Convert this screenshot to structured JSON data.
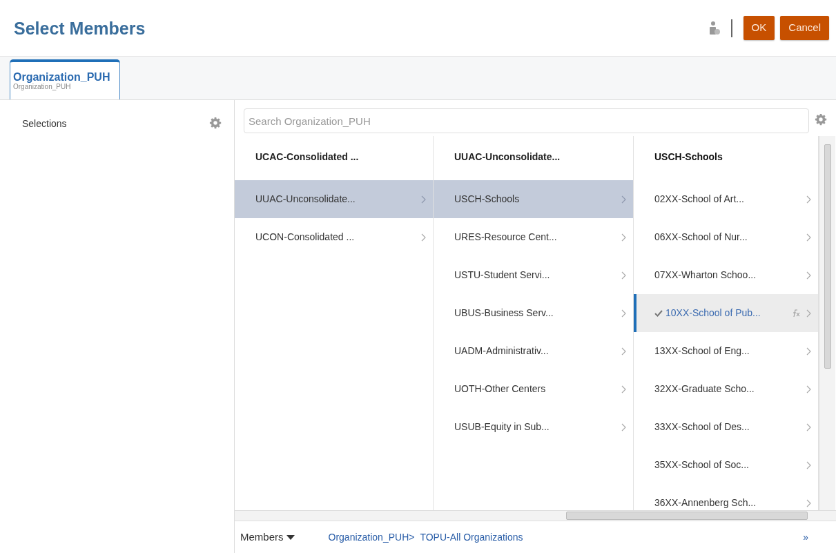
{
  "title": "Select Members",
  "buttons": [
    {
      "label": "OK"
    },
    {
      "label": "Cancel"
    }
  ],
  "tabs": [
    {
      "label": "Organization_PUH",
      "sublabel": "Organization_PUH",
      "selected": true
    }
  ],
  "selections": {
    "label": "Selections"
  },
  "search": {
    "placeholder": "Search Organization_PUH"
  },
  "columns": [
    {
      "heading": "UCAC-Consolidated ...",
      "active": false,
      "items": [
        {
          "label": "UUAC-Unconsolidate...",
          "selected": true,
          "checked": false,
          "formula": false
        },
        {
          "label": "UCON-Consolidated ...",
          "selected": false,
          "checked": false,
          "formula": false
        }
      ]
    },
    {
      "heading": "UUAC-Unconsolidate...",
      "active": false,
      "items": [
        {
          "label": "USCH-Schools",
          "selected": true,
          "checked": false,
          "formula": false
        },
        {
          "label": "URES-Resource Cent...",
          "selected": false,
          "checked": false,
          "formula": false
        },
        {
          "label": "USTU-Student Servi...",
          "selected": false,
          "checked": false,
          "formula": false
        },
        {
          "label": "UBUS-Business Serv...",
          "selected": false,
          "checked": false,
          "formula": false
        },
        {
          "label": "UADM-Administrativ...",
          "selected": false,
          "checked": false,
          "formula": false
        },
        {
          "label": "UOTH-Other Centers",
          "selected": false,
          "checked": false,
          "formula": false
        },
        {
          "label": "USUB-Equity in Sub...",
          "selected": false,
          "checked": false,
          "formula": false
        }
      ]
    },
    {
      "heading": "USCH-Schools",
      "active": true,
      "items": [
        {
          "label": "02XX-School of Art...",
          "selected": false,
          "checked": false,
          "formula": false
        },
        {
          "label": "06XX-School of Nur...",
          "selected": false,
          "checked": false,
          "formula": false
        },
        {
          "label": "07XX-Wharton Schoo...",
          "selected": false,
          "checked": false,
          "formula": false
        },
        {
          "label": "10XX-School of Pub...",
          "selected": true,
          "checked": true,
          "formula": true
        },
        {
          "label": "13XX-School of Eng...",
          "selected": false,
          "checked": false,
          "formula": false
        },
        {
          "label": "32XX-Graduate Scho...",
          "selected": false,
          "checked": false,
          "formula": false
        },
        {
          "label": "33XX-School of Des...",
          "selected": false,
          "checked": false,
          "formula": false
        },
        {
          "label": "35XX-School of Soc...",
          "selected": false,
          "checked": false,
          "formula": false
        },
        {
          "label": "36XX-Annenberg Sch...",
          "selected": false,
          "checked": false,
          "formula": false
        }
      ]
    }
  ],
  "footer": {
    "menu": "Members",
    "breadcrumbs": [
      "Organization_PUH>",
      "TOPU-All Organizations"
    ],
    "more": "»"
  }
}
